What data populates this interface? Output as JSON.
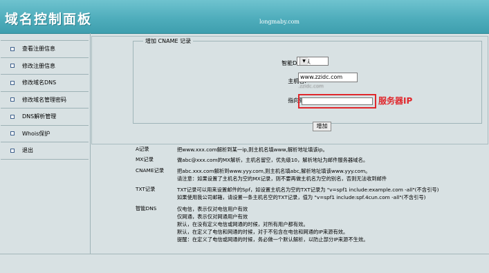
{
  "header": {
    "title": "域名控制面板",
    "site": "longmaby.com"
  },
  "sidebar": {
    "items": [
      {
        "label": "查看注册信息"
      },
      {
        "label": "修改注册信息"
      },
      {
        "label": "修改域名DNS"
      },
      {
        "label": "修改域名管理密码"
      },
      {
        "label": "DNS解析管理"
      },
      {
        "label": "Whois保护"
      },
      {
        "label": "退出"
      }
    ]
  },
  "form": {
    "legend": "增加 CNAME 记录",
    "dns_label": "智能DNS:",
    "dns_value": "默认",
    "host_label": "主机名:",
    "host_value": "www.zzidc.com",
    "host_hint": ".zzidc.com",
    "target_label": "指向到:",
    "target_value": "",
    "annotation": "服务器IP",
    "add_button": "增加"
  },
  "help": {
    "a": {
      "name": "A记录",
      "lines": [
        "把www.xxx.com解析到某一ip,则主机名填www,解析地址填该ip。"
      ]
    },
    "mx": {
      "name": "MX记录",
      "lines": [
        "做abc@xxx.com的MX解析，主机名留空，优先级10，解析地址为邮件服务器域名。"
      ]
    },
    "cname": {
      "name": "CNAME记录",
      "lines": [
        "把abc.xxx.com解析到www.yyy.com,则主机名填abc,解析地址填该www.yyy.com。",
        "请注意：如果设置了主机名为空的MX记录，则不要再做主机名为空的别名，否则无法收到邮件"
      ]
    },
    "txt": {
      "name": "TXT记录",
      "lines": [
        "TXT记录可以用来设置邮件的Spf，如设置主机名为空的TXT记录为 \"v=spf1 include:example.com -all\"(不含引号)",
        "如果使用我公司邮箱，请设置一条主机名空的TXT记录，值为 \"v=spf1 include:spf.4cun.com -all\"(不含引号)"
      ]
    },
    "smart": {
      "name": "智能DNS",
      "lines": [
        "仅电信，表示仅对电信用户有效",
        "仅网通，表示仅对网通用户有效",
        "默认，在没有定义电信或网通的时候，对所有用户都有效。",
        "默认，在定义了电信和网通的时候，对于不包含在电信和网通的IP来源有效。",
        "提醒：在定义了电信或网通的时候，务必做一个默认解析，以防止部分IP来源不生效。"
      ]
    }
  },
  "colors": {
    "header": "#4fadbc",
    "background": "#d8e1e3",
    "highlight": "#e0262b"
  }
}
